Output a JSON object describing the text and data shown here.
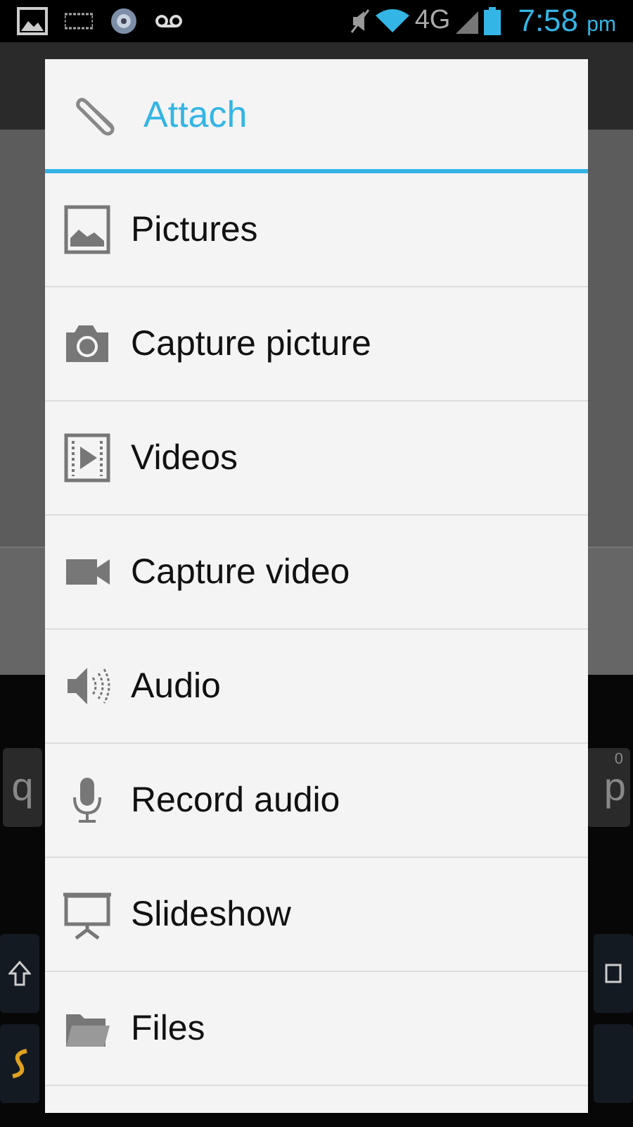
{
  "status_bar": {
    "network": "4G",
    "time": "7:58",
    "period": "pm"
  },
  "keyboard": {
    "left_key": "q",
    "right_key": "p",
    "right_key_hint": "0"
  },
  "dialog": {
    "title": "Attach",
    "items": [
      {
        "kind": "picture",
        "label": "Pictures"
      },
      {
        "kind": "camera",
        "label": "Capture picture"
      },
      {
        "kind": "film",
        "label": "Videos"
      },
      {
        "kind": "camcorder",
        "label": "Capture video"
      },
      {
        "kind": "speaker",
        "label": "Audio"
      },
      {
        "kind": "microphone",
        "label": "Record audio"
      },
      {
        "kind": "screen",
        "label": "Slideshow"
      },
      {
        "kind": "folder",
        "label": "Files"
      }
    ]
  }
}
